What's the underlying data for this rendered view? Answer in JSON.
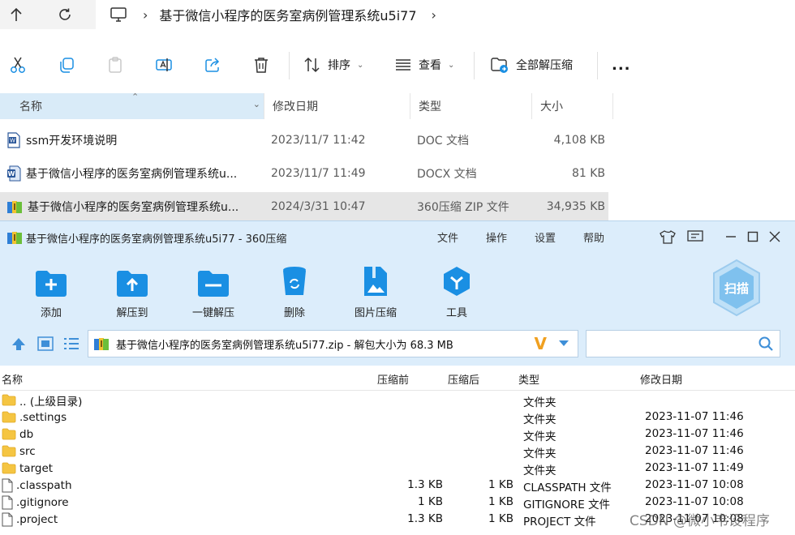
{
  "explorer": {
    "breadcrumb": "基于微信小程序的医务室病例管理系统u5i77",
    "toolbar": {
      "sort_label": "排序",
      "view_label": "查看",
      "extract_label": "全部解压缩",
      "more_label": "..."
    },
    "columns": {
      "name": "名称",
      "date": "修改日期",
      "type": "类型",
      "size": "大小"
    },
    "files": [
      {
        "name": "ssm开发环境说明",
        "date": "2023/11/7 11:42",
        "type": "DOC 文档",
        "size": "4,108 KB",
        "icon": "word-doc-icon"
      },
      {
        "name": "基于微信小程序的医务室病例管理系统u...",
        "date": "2023/11/7 11:49",
        "type": "DOCX 文档",
        "size": "81 KB",
        "icon": "word-docx-icon"
      },
      {
        "name": "基于微信小程序的医务室病例管理系统u...",
        "date": "2024/3/31 10:47",
        "type": "360压缩 ZIP 文件",
        "size": "34,935 KB",
        "icon": "zip-archive-icon"
      }
    ]
  },
  "zip_window": {
    "title": "基于微信小程序的医务室病例管理系统u5i77 - 360压缩",
    "menu": [
      "文件",
      "操作",
      "设置",
      "帮助"
    ],
    "tools": [
      "添加",
      "解压到",
      "一键解压",
      "删除",
      "图片压缩",
      "工具"
    ],
    "scan_label": "扫描",
    "path": "基于微信小程序的医务室病例管理系统u5i77.zip - 解包大小为 68.3 MB",
    "search_placeholder": "",
    "columns": {
      "name": "名称",
      "compressed": "压缩前",
      "original": "压缩后",
      "type": "类型",
      "date": "修改日期"
    },
    "rows": [
      {
        "name": ".. (上级目录)",
        "compressed": "",
        "original": "",
        "type": "文件夹",
        "date": "",
        "kind": "folder"
      },
      {
        "name": ".settings",
        "compressed": "",
        "original": "",
        "type": "文件夹",
        "date": "2023-11-07 11:46",
        "kind": "folder"
      },
      {
        "name": "db",
        "compressed": "",
        "original": "",
        "type": "文件夹",
        "date": "2023-11-07 11:46",
        "kind": "folder"
      },
      {
        "name": "src",
        "compressed": "",
        "original": "",
        "type": "文件夹",
        "date": "2023-11-07 11:46",
        "kind": "folder"
      },
      {
        "name": "target",
        "compressed": "",
        "original": "",
        "type": "文件夹",
        "date": "2023-11-07 11:49",
        "kind": "folder"
      },
      {
        "name": ".classpath",
        "compressed": "1.3 KB",
        "original": "1 KB",
        "type": "CLASSPATH 文件",
        "date": "2023-11-07 10:08",
        "kind": "file"
      },
      {
        "name": ".gitignore",
        "compressed": "1 KB",
        "original": "1 KB",
        "type": "GITIGNORE 文件",
        "date": "2023-11-07 10:08",
        "kind": "file"
      },
      {
        "name": ".project",
        "compressed": "1.3 KB",
        "original": "1 KB",
        "type": "PROJECT 文件",
        "date": "2023-11-07 10:08",
        "kind": "file"
      }
    ]
  },
  "watermark": "CSDN @微小韦设程序",
  "colors": {
    "accent_blue": "#1a8fe3",
    "folder_yellow": "#f5c542",
    "header_blue": "#d9ebf8",
    "zip_bg": "#dcedfb"
  }
}
